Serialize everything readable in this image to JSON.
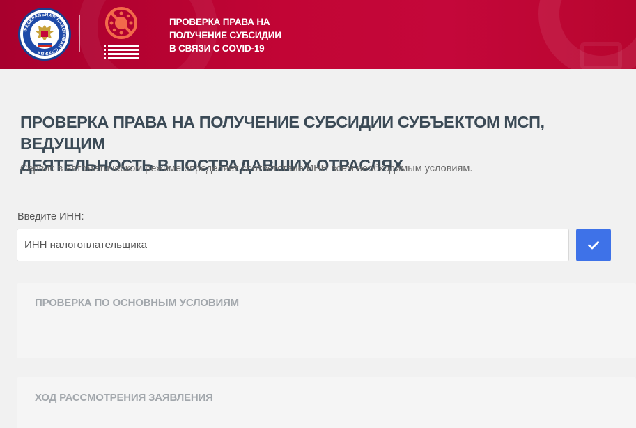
{
  "header": {
    "title_lines": [
      "ПРОВЕРКА ПРАВА НА",
      "ПОЛУЧЕНИЕ СУБСИДИИ",
      "В СВЯЗИ С COVID-19"
    ],
    "emblem_text": "ФЕДЕРАЛЬНАЯ НАЛОГОВАЯ СЛУЖБА",
    "colors": {
      "background": "#c20535",
      "emblem_blue": "#1f4aa8",
      "covid_icon": "#f26a4b"
    }
  },
  "main": {
    "title_lines": [
      "ПРОВЕРКА ПРАВА НА ПОЛУЧЕНИЕ СУБСИДИИ СУБЪЕКТОМ МСП, ВЕДУЩИМ",
      "ДЕЯТЕЛЬНОСТЬ В ПОСТРАДАВШИХ ОТРАСЛЯХ"
    ],
    "subtitle": "Сервис в автоматическом режиме определяет соответствие ИНН всем необходимым условиям.",
    "inn_label": "Введите ИНН:",
    "inn_value": "",
    "inn_placeholder": "ИНН налогоплательщика",
    "submit_icon": "check-icon",
    "accent": "#3e72e8"
  },
  "panels": [
    {
      "title": "ПРОВЕРКА ПО ОСНОВНЫМ УСЛОВИЯМ"
    },
    {
      "title": "ХОД РАССМОТРЕНИЯ ЗАЯВЛЕНИЯ"
    }
  ]
}
